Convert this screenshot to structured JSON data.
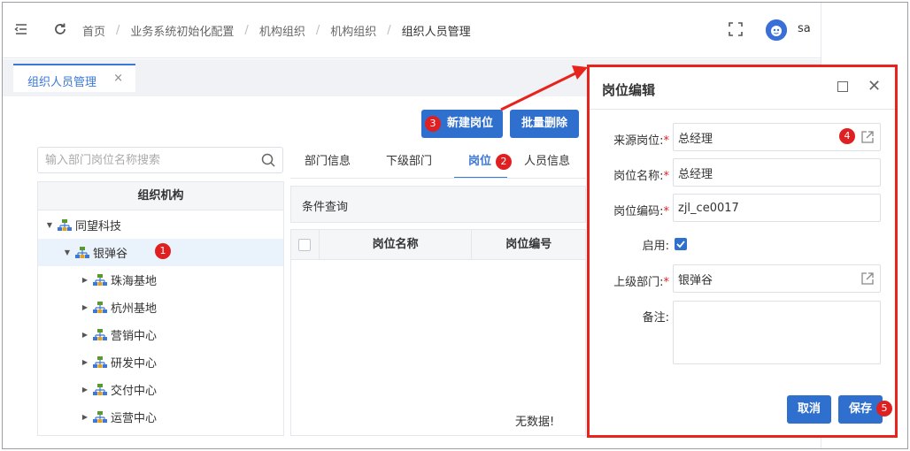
{
  "header": {
    "breadcrumb": [
      "首页",
      "业务系统初始化配置",
      "机构组织",
      "机构组织",
      "组织人员管理"
    ],
    "username": "sa"
  },
  "tabs": {
    "active_tab": "组织人员管理",
    "close_glyph": "×"
  },
  "toolbar": {
    "new_position": "新建岗位",
    "batch_delete": "批量删除"
  },
  "search": {
    "placeholder": "输入部门岗位名称搜索"
  },
  "tree": {
    "header": "组织机构",
    "nodes": [
      {
        "label": "同望科技",
        "expanded": true,
        "level": 0
      },
      {
        "label": "银弹谷",
        "expanded": true,
        "level": 1,
        "selected": true
      },
      {
        "label": "珠海基地",
        "expanded": false,
        "level": 2
      },
      {
        "label": "杭州基地",
        "expanded": false,
        "level": 2
      },
      {
        "label": "营销中心",
        "expanded": false,
        "level": 2
      },
      {
        "label": "研发中心",
        "expanded": false,
        "level": 2
      },
      {
        "label": "交付中心",
        "expanded": false,
        "level": 2
      },
      {
        "label": "运营中心",
        "expanded": false,
        "level": 2
      }
    ]
  },
  "subtabs": [
    "部门信息",
    "下级部门",
    "岗位",
    "人员信息"
  ],
  "active_subtab": "岗位",
  "condition_query": "条件查询",
  "grid": {
    "columns": [
      "岗位名称",
      "岗位编号"
    ],
    "empty_text": "无数据!"
  },
  "dialog": {
    "title": "岗位编辑",
    "fields": {
      "source_position": {
        "label": "来源岗位",
        "value": "总经理"
      },
      "position_name": {
        "label": "岗位名称",
        "value": "总经理"
      },
      "position_code": {
        "label": "岗位编码",
        "value": "zjl_ce0017"
      },
      "enabled": {
        "label": "启用",
        "checked": true
      },
      "parent_dept": {
        "label": "上级部门",
        "value": "银弹谷"
      },
      "remark": {
        "label": "备注",
        "value": ""
      }
    },
    "label_suffix": ":",
    "required_mark": "*",
    "cancel": "取消",
    "save": "保存"
  },
  "badges": [
    "1",
    "2",
    "3",
    "4",
    "5"
  ],
  "colors": {
    "primary": "#2f6fcd",
    "accent_blue": "#3b78d8",
    "highlight_red": "#e8231c",
    "badge_red": "#e02020"
  }
}
